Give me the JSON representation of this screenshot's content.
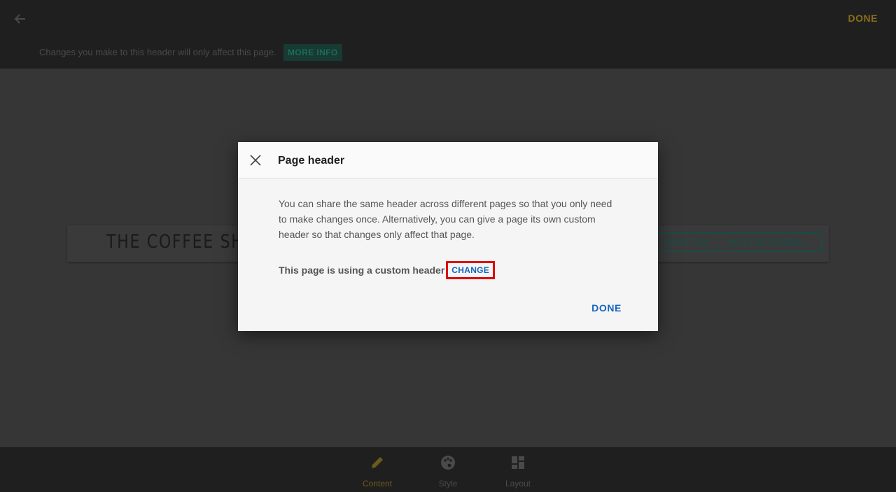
{
  "topbar": {
    "done_label": "DONE"
  },
  "infobar": {
    "text": "Changes you make to this header will only affect this page.",
    "more_info_label": "MORE INFO"
  },
  "site_header": {
    "title": "THE COFFEE SHOP",
    "nav": [
      "ABOUT US",
      "OUR LOCATIONS"
    ]
  },
  "toolbar": {
    "items": [
      {
        "label": "Content",
        "icon": "pencil-icon"
      },
      {
        "label": "Style",
        "icon": "palette-icon"
      },
      {
        "label": "Layout",
        "icon": "layout-icon"
      }
    ]
  },
  "dialog": {
    "title": "Page header",
    "body": "You can share the same header across different pages so that you only need to make changes once. Alternatively, you can give a page its own custom header so that changes only affect that page.",
    "status": "This page is using a custom header",
    "change_label": "CHANGE",
    "done_label": "DONE"
  },
  "colors": {
    "accent_blue": "#1565c0",
    "highlight_red": "#e00000",
    "backdrop": "#333333",
    "dialog_bg": "#f5f5f5"
  }
}
